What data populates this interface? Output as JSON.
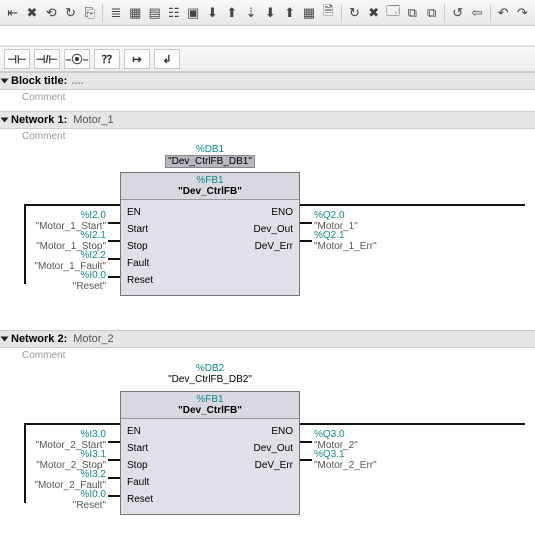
{
  "toolbar": {
    "icons": [
      "⇤",
      "✖",
      "⟲",
      "↻",
      "⎘",
      "≣",
      "▦",
      "▤",
      "☷",
      "▣",
      "⬇",
      "⬆",
      "⇣",
      "⬇",
      "⬆",
      "▦",
      "🗎",
      "↻",
      "✖",
      "🗔",
      "⧉",
      "⧉",
      "↺",
      "⇦",
      "↶",
      "↷"
    ]
  },
  "toolbar2": {
    "btns": [
      "⊣⊢",
      "⊣/⊢",
      "–⦿–",
      "⁇",
      "↦",
      "↲"
    ]
  },
  "block_title_label": "Block title:",
  "block_title_value": "....",
  "comment_label": "Comment",
  "networks": [
    {
      "label": "Network 1:",
      "name": "Motor_1",
      "comment": "Comment",
      "db_addr": "%DB1",
      "db_name": "\"Dev_CtrlFB_DB1\"",
      "fb_addr": "%FB1",
      "fb_name": "\"Dev_CtrlFB\"",
      "en": "EN",
      "eno": "ENO",
      "inputs": [
        {
          "addr": "%I2.0",
          "name": "\"Motor_1_Start\"",
          "pin": "Start"
        },
        {
          "addr": "%I2.1",
          "name": "\"Motor_1_Stop\"",
          "pin": "Stop"
        },
        {
          "addr": "%I2.2",
          "name": "\"Motor_1_Fault\"",
          "pin": "Fault"
        },
        {
          "addr": "%I0.0",
          "name": "\"Reset\"",
          "pin": "Reset"
        }
      ],
      "outputs": [
        {
          "addr": "%Q2.0",
          "name": "\"Motor_1\"",
          "pin": "Dev_Out"
        },
        {
          "addr": "%Q2.1",
          "name": "\"Motor_1_Err\"",
          "pin": "DeV_Err"
        }
      ]
    },
    {
      "label": "Network 2:",
      "name": "Motor_2",
      "comment": "Comment",
      "db_addr": "%DB2",
      "db_name": "\"Dev_CtrlFB_DB2\"",
      "fb_addr": "%FB1",
      "fb_name": "\"Dev_CtrlFB\"",
      "en": "EN",
      "eno": "ENO",
      "inputs": [
        {
          "addr": "%I3.0",
          "name": "\"Motor_2_Start\"",
          "pin": "Start"
        },
        {
          "addr": "%I3.1",
          "name": "\"Motor_2_Stop\"",
          "pin": "Stop"
        },
        {
          "addr": "%I3.2",
          "name": "\"Motor_2_Fault\"",
          "pin": "Fault"
        },
        {
          "addr": "%I0.0",
          "name": "\"Reset\"",
          "pin": "Reset"
        }
      ],
      "outputs": [
        {
          "addr": "%Q3.0",
          "name": "\"Motor_2\"",
          "pin": "Dev_Out"
        },
        {
          "addr": "%Q3.1",
          "name": "\"Motor_2_Err\"",
          "pin": "DeV_Err"
        }
      ]
    }
  ]
}
